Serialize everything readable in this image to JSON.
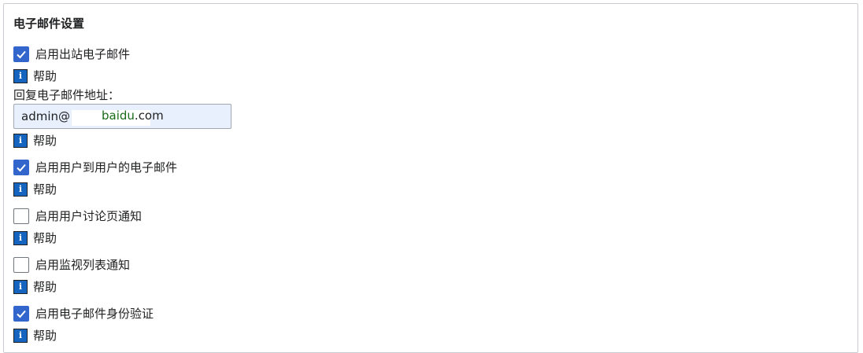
{
  "section": {
    "title": "电子邮件设置"
  },
  "help_label": "帮助",
  "info_icon_glyph": "i",
  "settings": [
    {
      "label": "启用出站电子邮件",
      "checked": true
    },
    {
      "label": "启用用户到用户的电子邮件",
      "checked": true
    },
    {
      "label": "启用用户讨论页通知",
      "checked": false
    },
    {
      "label": "启用监视列表通知",
      "checked": false
    },
    {
      "label": "启用电子邮件身份验证",
      "checked": true
    }
  ],
  "reply_email": {
    "label": "回复电子邮件地址：",
    "value": "admin@",
    "domain_visible": "baidu",
    "tld_visible": ".com"
  },
  "colors": {
    "accent": "#3366cc",
    "info_icon": "#1565c0",
    "input_bg": "#e8f0fe"
  }
}
